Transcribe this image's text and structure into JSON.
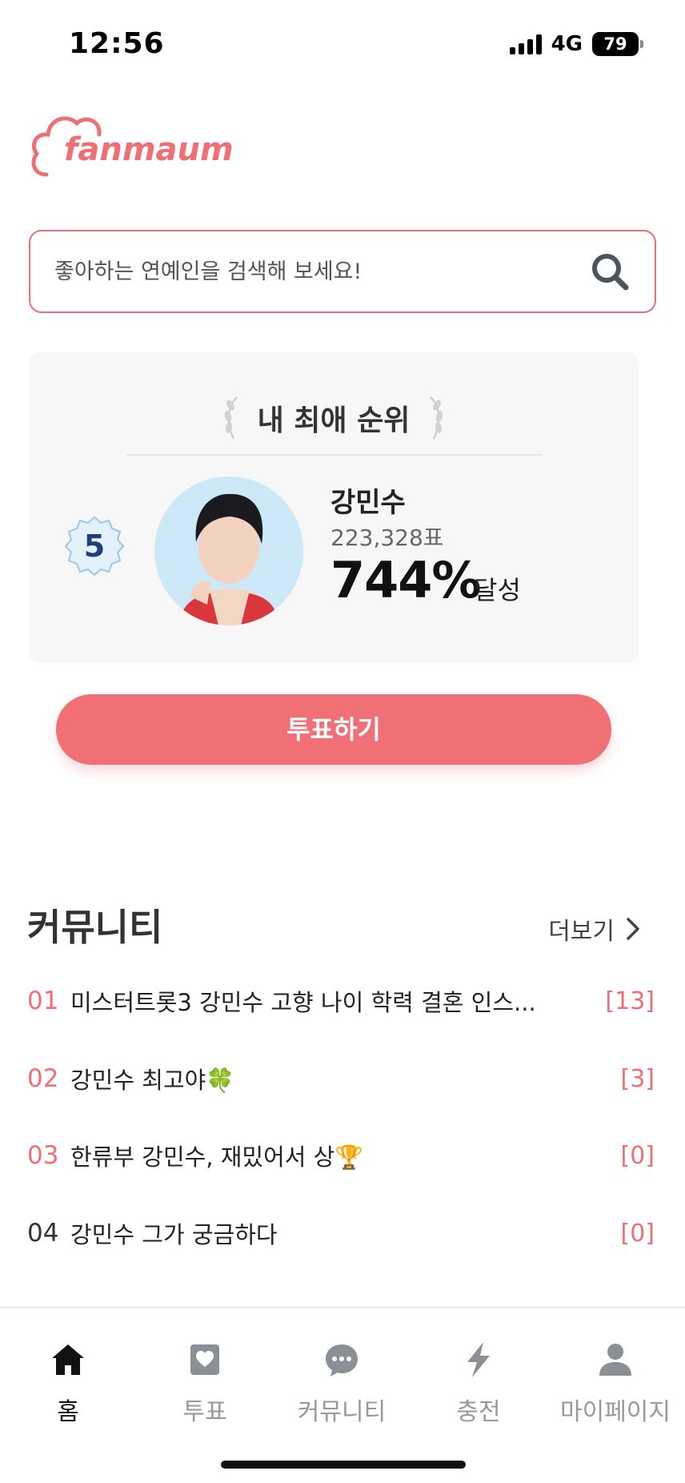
{
  "status_bar": {
    "time": "12:56",
    "network": "4G",
    "battery": "79"
  },
  "logo": {
    "text": "fanmaum"
  },
  "search": {
    "placeholder": "좋아하는 연예인을 검색해 보세요!"
  },
  "ranking": {
    "title": "내 최애 순위",
    "rank": "5",
    "artist_name": "강민수",
    "votes": "223,328표",
    "percent": "744%",
    "percent_suffix": "달성"
  },
  "vote_button": {
    "label": "투표하기"
  },
  "community": {
    "title": "커뮤니티",
    "more_label": "더보기",
    "posts": [
      {
        "num": "01",
        "title": "미스터트롯3 강민수 고향 나이 학력 결혼 인스...",
        "count": "[13]"
      },
      {
        "num": "02",
        "title": "강민수 최고야🍀",
        "count": "[3]"
      },
      {
        "num": "03",
        "title": "한류부 강민수, 재밌어서 상🏆",
        "count": "[0]"
      },
      {
        "num": "04",
        "title": "강민수 그가 궁금하다",
        "count": "[0]"
      }
    ]
  },
  "tab_bar": {
    "tabs": [
      {
        "label": "홈",
        "icon": "home-icon"
      },
      {
        "label": "투표",
        "icon": "vote-icon"
      },
      {
        "label": "커뮤니티",
        "icon": "chat-icon"
      },
      {
        "label": "충전",
        "icon": "lightning-icon"
      },
      {
        "label": "마이페이지",
        "icon": "user-icon"
      }
    ]
  },
  "colors": {
    "accent": "#ef6f77",
    "rank_badge": "#1f3f7a"
  }
}
